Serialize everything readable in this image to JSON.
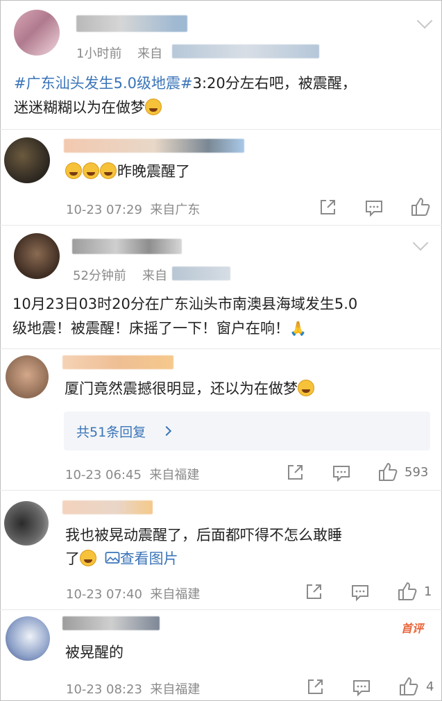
{
  "comment1": {
    "time": "1小时前",
    "source_label": "来自",
    "text_hashtag": "#广东汕头发生5.0级地震#",
    "text_line1_rest": "3:20分左右吧，被震醒，",
    "text_line2": "迷迷糊糊以为在做梦"
  },
  "reply1": {
    "text": "昨晚震醒了",
    "meta": "10-23 07:29  来自广东"
  },
  "comment2": {
    "time": "52分钟前",
    "source_label": "来自",
    "text_line1": "10月23日03时20分在广东汕头市南澳县海域发生5.0",
    "text_line2": "级地震！被震醒！床摇了一下！窗户在响！"
  },
  "reply2": {
    "text": "厦门竟然震撼很明显，还以为在做梦",
    "replies_link": "共51条回复",
    "meta": "10-23 06:45  来自福建",
    "likes": "593"
  },
  "reply3": {
    "text_line1": "我也被晃动震醒了，后面都吓得不怎么敢睡",
    "text_line2": "了",
    "view_image": "查看图片",
    "meta": "10-23 07:40  来自福建",
    "likes": "1"
  },
  "reply4": {
    "badge": "首评",
    "text": "被晃醒的",
    "meta": "10-23 08:23  来自福建",
    "likes": "4"
  },
  "colors": {
    "link": "#3a74b8",
    "meta": "#8a8a8a",
    "badge": "#e8663a"
  }
}
